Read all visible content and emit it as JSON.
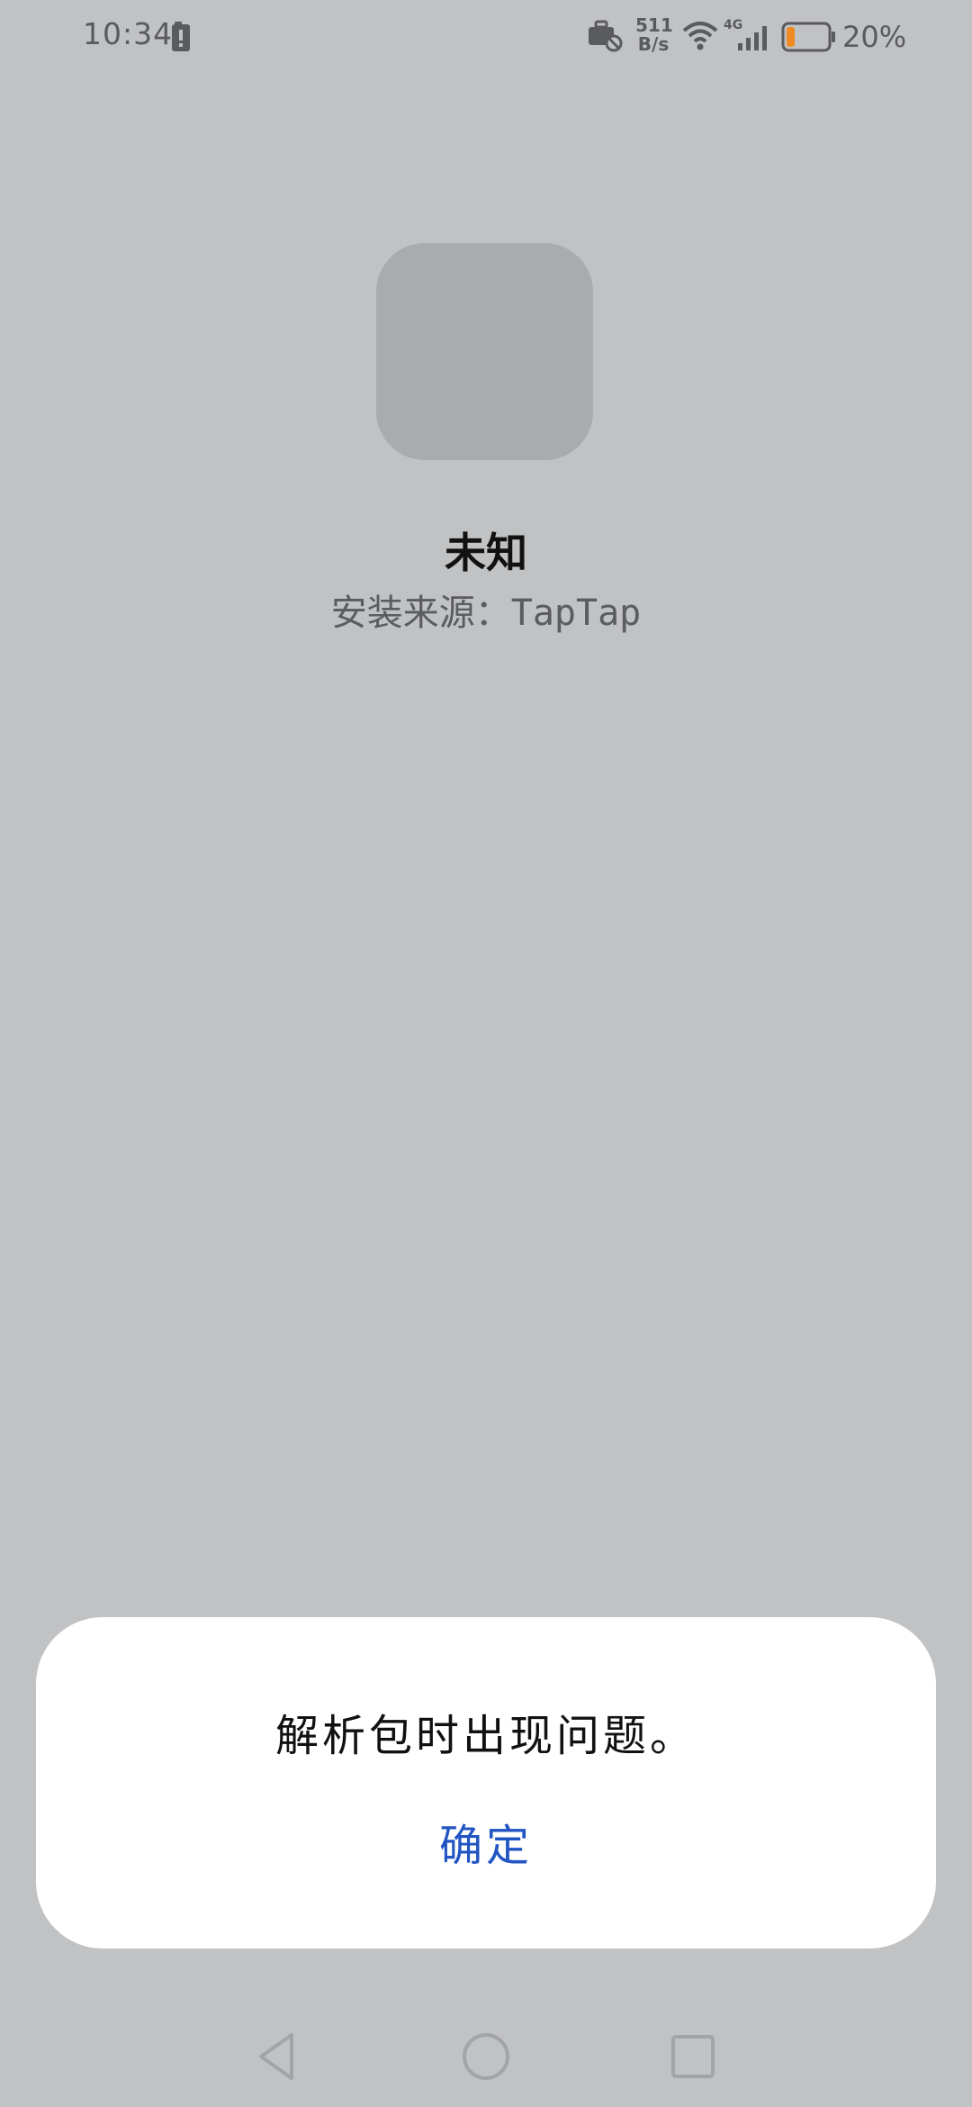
{
  "status_bar": {
    "time": "10:34",
    "net_speed_value": "511",
    "net_speed_unit": "B/s",
    "network_type": "4G",
    "battery_percent": "20%",
    "icons": [
      "battery-charging-icon",
      "briefcase-blocked-icon",
      "wifi-icon",
      "signal-icon",
      "battery-icon"
    ],
    "battery_level": 0.2,
    "battery_fill_color": "#f08a24"
  },
  "app": {
    "name": "未知",
    "install_source_label": "安装来源：",
    "install_source_value": "TapTap",
    "icon_placeholder_color": "#aaabad"
  },
  "dialog": {
    "message": "解析包时出现问题。",
    "ok_label": "确定",
    "accent_color": "#2255c4"
  },
  "nav_bar": {
    "buttons": [
      "back-icon",
      "home-icon",
      "recents-icon"
    ]
  },
  "colors": {
    "background_scrim": "#c1c2c4",
    "dialog_bg": "#ffffff"
  }
}
